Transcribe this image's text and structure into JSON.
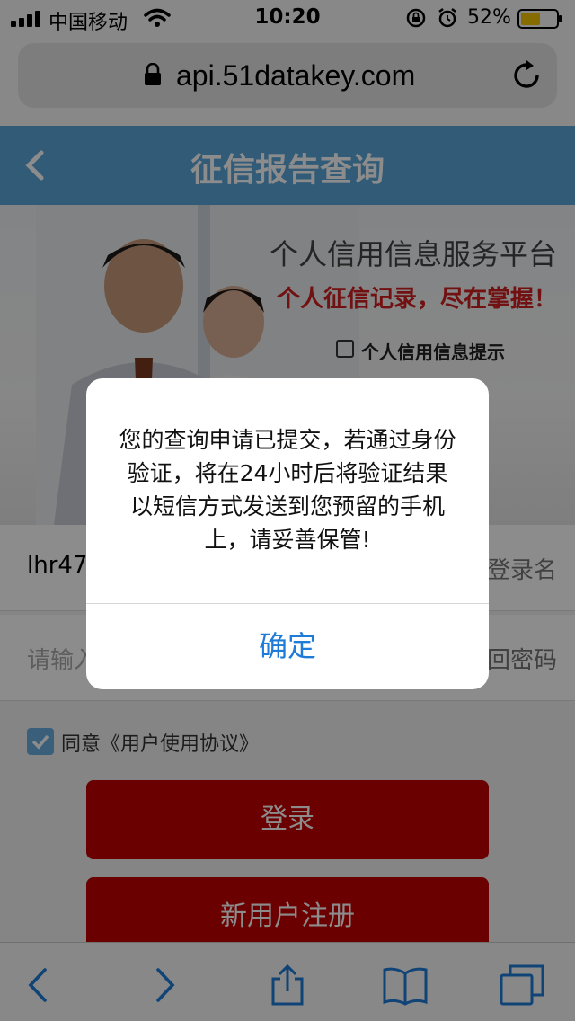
{
  "status_bar": {
    "carrier": "中国移动",
    "time": "10:20",
    "battery_percent": "52%"
  },
  "browser": {
    "url": "api.51datakey.com"
  },
  "page": {
    "title": "征信报告查询",
    "banner": {
      "line1": "个人信用信息服务平台",
      "line2": "个人征信记录，尽在掌握！",
      "line3": "个人信用信息提示"
    },
    "username_value": "lhr474",
    "username_link": "登录名",
    "password_placeholder": "请输入",
    "password_link": "回密码",
    "agree_label": "同意《用户使用协议》",
    "login_button": "登录",
    "register_button": "新用户注册"
  },
  "alert": {
    "message": "您的查询申请已提交，若通过身份验证，将在24小时后将验证结果以短信方式发送到您预留的手机上，请妥善保管!",
    "confirm": "确定"
  },
  "colors": {
    "header": "#5aa7d9",
    "button": "#c40000",
    "alert_action": "#1e7bd8"
  }
}
